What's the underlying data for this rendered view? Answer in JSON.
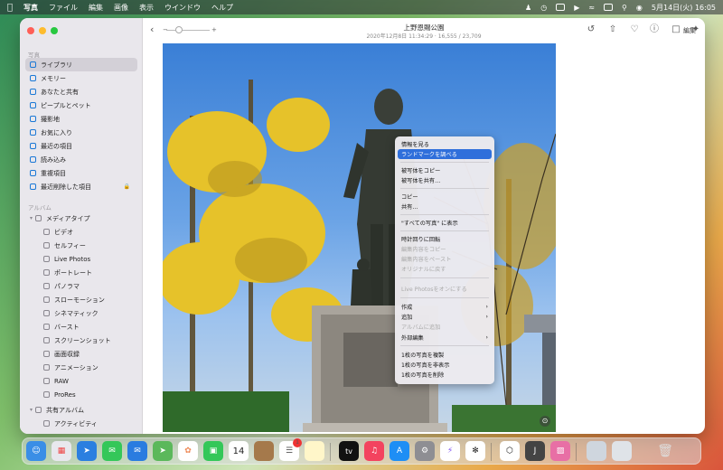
{
  "menubar": {
    "items": [
      "写真",
      "ファイル",
      "編集",
      "画像",
      "表示",
      "ウインドウ",
      "ヘルプ"
    ],
    "clock": "5月14日(火) 16:05"
  },
  "toolbar": {
    "zoom_minus": "−",
    "zoom_plus": "+",
    "title": "上野恩賜公園",
    "subtitle": "2020年12月8日 11:34:29 · 16,555 / 23,709",
    "edit_label": "編集"
  },
  "sidebar": {
    "section_photos": "写真",
    "items": [
      {
        "label": "ライブラリ"
      },
      {
        "label": "メモリー"
      },
      {
        "label": "あなたと共有"
      },
      {
        "label": "ピープルとペット"
      },
      {
        "label": "撮影地"
      },
      {
        "label": "お気に入り"
      },
      {
        "label": "最近の項目"
      },
      {
        "label": "読み込み"
      },
      {
        "label": "重複項目"
      },
      {
        "label": "最近削除した項目"
      }
    ],
    "section_albums": "アルバム",
    "media_types": "メディアタイプ",
    "media_items": [
      {
        "label": "ビデオ"
      },
      {
        "label": "セルフィー"
      },
      {
        "label": "Live Photos"
      },
      {
        "label": "ポートレート"
      },
      {
        "label": "パノラマ"
      },
      {
        "label": "スローモーション"
      },
      {
        "label": "シネマティック"
      },
      {
        "label": "バースト"
      },
      {
        "label": "スクリーンショット"
      },
      {
        "label": "画面収録"
      },
      {
        "label": "アニメーション"
      },
      {
        "label": "RAW"
      },
      {
        "label": "ProRes"
      }
    ],
    "shared_albums": "共有アルバム",
    "activity": "アクティビティ"
  },
  "context_menu": {
    "items": [
      {
        "label": "情報を見る"
      },
      {
        "label": "ランドマークを調べる"
      },
      {
        "label": "被写体をコピー"
      },
      {
        "label": "被写体を共有…"
      },
      {
        "label": "コピー"
      },
      {
        "label": "共有…"
      },
      {
        "label": "\"すべての写真\" に表示"
      },
      {
        "label": "時計回りに回転"
      },
      {
        "label": "編集内容をコピー"
      },
      {
        "label": "編集内容をペースト"
      },
      {
        "label": "オリジナルに戻す"
      },
      {
        "label": "Live Photosをオンにする"
      },
      {
        "label": "作成"
      },
      {
        "label": "追加"
      },
      {
        "label": "アルバムに追加"
      },
      {
        "label": "外部編集"
      },
      {
        "label": "1枚の写真を複製"
      },
      {
        "label": "1枚の写真を非表示"
      },
      {
        "label": "1枚の写真を削除"
      }
    ]
  },
  "dock": {
    "calendar_day": "14",
    "reminders_badge": "1",
    "tv_label": "tv"
  },
  "colors": {
    "accent": "#2f6fdb",
    "sidebar_bg": "#e9e7ec",
    "traffic_red": "#ff5f57",
    "traffic_yellow": "#febc2e",
    "traffic_green": "#28c840"
  }
}
